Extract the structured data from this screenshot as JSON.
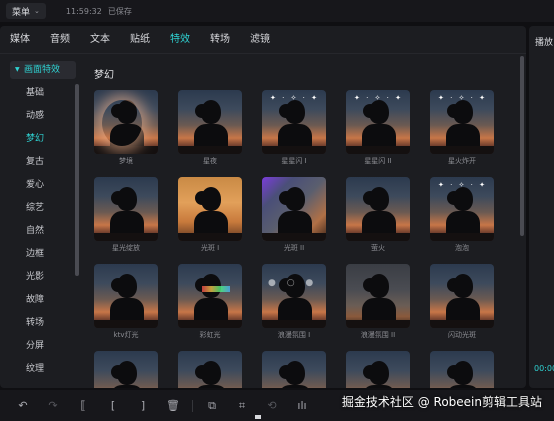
{
  "topbar": {
    "menu_label": "菜单",
    "time": "11:59:32",
    "status": "已保存"
  },
  "tabs": [
    {
      "label": "媒体",
      "active": false
    },
    {
      "label": "音频",
      "active": false
    },
    {
      "label": "文本",
      "active": false
    },
    {
      "label": "贴纸",
      "active": false
    },
    {
      "label": "特效",
      "active": true
    },
    {
      "label": "转场",
      "active": false
    },
    {
      "label": "滤镜",
      "active": false
    }
  ],
  "sidebar": {
    "header": "画面特效",
    "items": [
      "基础",
      "动感",
      "梦幻",
      "复古",
      "爱心",
      "综艺",
      "自然",
      "边框",
      "光影",
      "故障",
      "转场",
      "分屏",
      "纹理"
    ],
    "active": "梦幻"
  },
  "section_title": "梦幻",
  "effects": [
    {
      "label": "梦境",
      "style": "glow"
    },
    {
      "label": "星夜",
      "style": ""
    },
    {
      "label": "星星闪 I",
      "style": "sparkle"
    },
    {
      "label": "星星闪 II",
      "style": "sparkle"
    },
    {
      "label": "星火炸开",
      "style": "sparkle"
    },
    {
      "label": "星光绽放",
      "style": ""
    },
    {
      "label": "光斑 I",
      "style": "warm"
    },
    {
      "label": "光斑 II",
      "style": "purple"
    },
    {
      "label": "萤火",
      "style": ""
    },
    {
      "label": "泡泡",
      "style": "sparkle"
    },
    {
      "label": "ktv灯光",
      "style": ""
    },
    {
      "label": "彩虹光",
      "style": "rainbow"
    },
    {
      "label": "浪漫氛围 I",
      "style": "bokeh"
    },
    {
      "label": "浪漫氛围 II",
      "style": "dim"
    },
    {
      "label": "闪动光斑",
      "style": ""
    },
    {
      "label": "",
      "style": ""
    },
    {
      "label": "",
      "style": ""
    },
    {
      "label": "",
      "style": ""
    },
    {
      "label": "",
      "style": ""
    },
    {
      "label": "",
      "style": ""
    }
  ],
  "right_panel": {
    "title": "播放",
    "time": "00:00"
  },
  "toolbar": {
    "icons": [
      "undo-icon",
      "redo-icon",
      "split-icon",
      "trim-left-icon",
      "trim-right-icon",
      "delete-icon",
      "copy-icon",
      "crop-icon",
      "rotate-icon",
      "audio-wave-icon"
    ]
  },
  "watermark": "掘金技术社区 @ Robeein剪辑工具站"
}
